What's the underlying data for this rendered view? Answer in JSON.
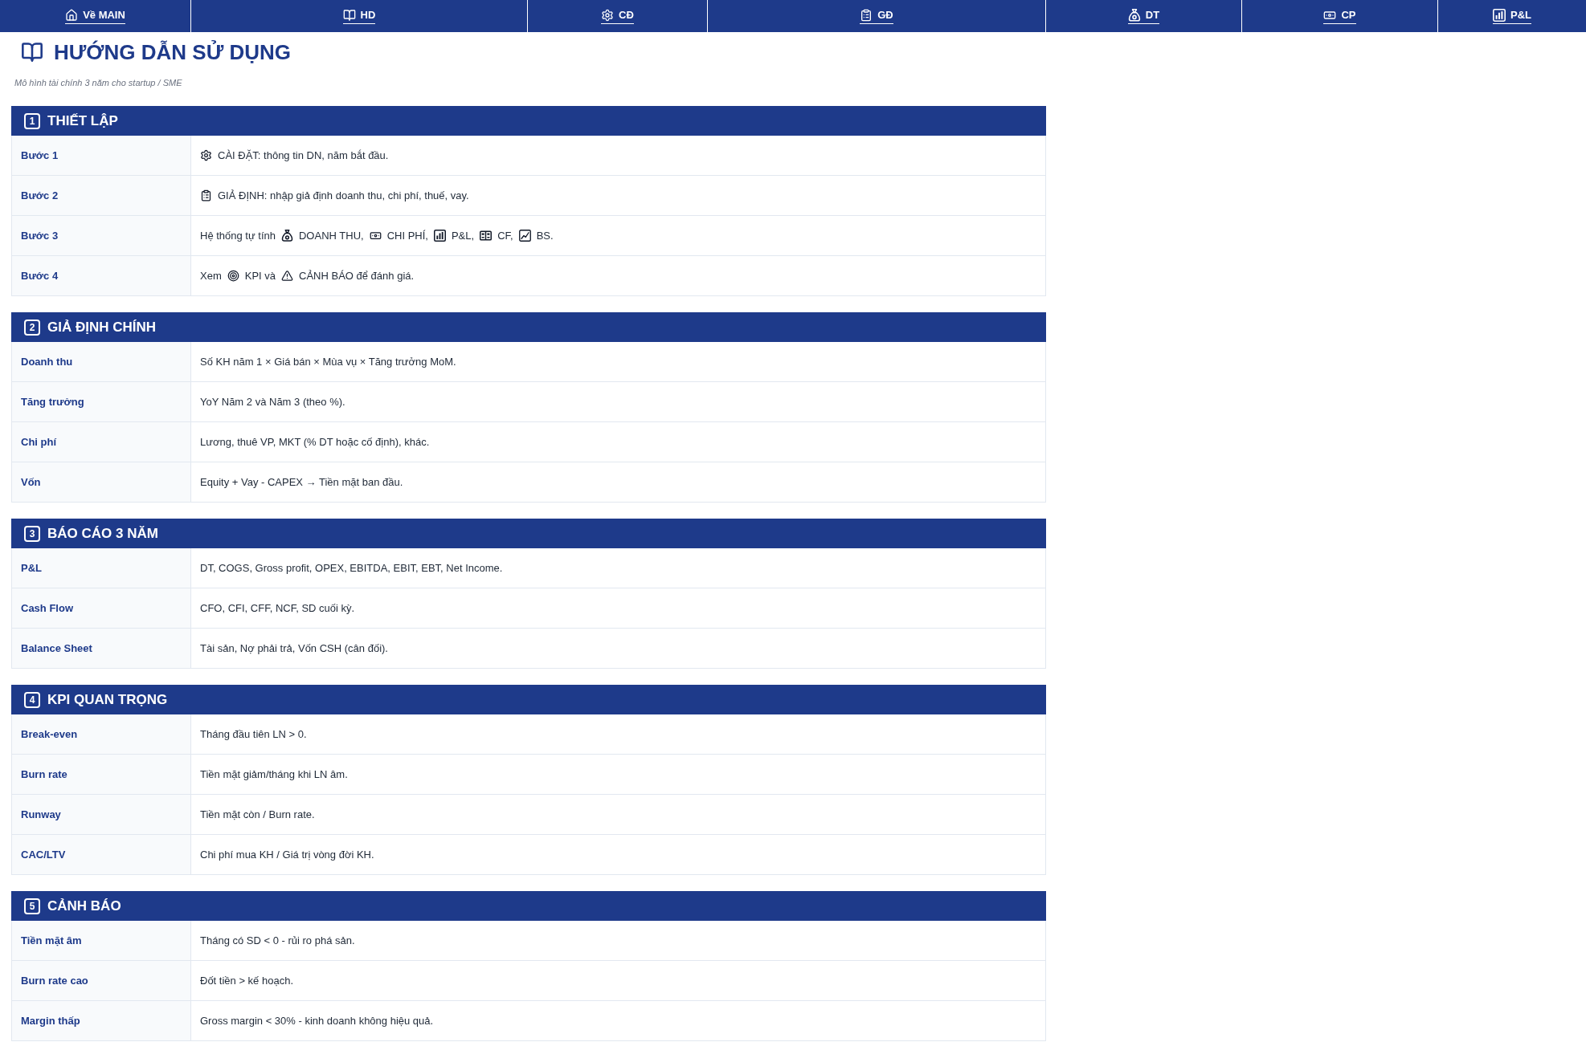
{
  "nav": [
    {
      "label": "Về MAIN"
    },
    {
      "label": "HD"
    },
    {
      "label": "CĐ"
    },
    {
      "label": "GĐ"
    },
    {
      "label": "DT"
    },
    {
      "label": "CP"
    },
    {
      "label": "P&L"
    }
  ],
  "title": "HƯỚNG DẪN SỬ DỤNG",
  "subtitle": "Mô hình tài chính 3 năm cho startup / SME",
  "sections": [
    {
      "number": "1",
      "title": "THIẾT LẬP",
      "rows": [
        {
          "label": "Bước 1",
          "parts": [
            {
              "kind": "icon"
            },
            {
              "kind": "text",
              "text": "CÀI ĐẶT: thông tin DN, năm bắt đầu."
            }
          ]
        },
        {
          "label": "Bước 2",
          "parts": [
            {
              "kind": "icon"
            },
            {
              "kind": "text",
              "text": "GIẢ ĐỊNH: nhập giả định doanh thu, chi phí, thuế, vay."
            }
          ]
        },
        {
          "label": "Bước 3",
          "parts": [
            {
              "kind": "text",
              "text": "Hệ thống tự tính"
            },
            {
              "kind": "icon"
            },
            {
              "kind": "text",
              "text": "DOANH THU,"
            },
            {
              "kind": "icon"
            },
            {
              "kind": "text",
              "text": "CHI PHÍ,"
            },
            {
              "kind": "icon"
            },
            {
              "kind": "text",
              "text": "P&L,"
            },
            {
              "kind": "icon"
            },
            {
              "kind": "text",
              "text": "CF,"
            },
            {
              "kind": "icon"
            },
            {
              "kind": "text",
              "text": "BS."
            }
          ]
        },
        {
          "label": "Bước 4",
          "parts": [
            {
              "kind": "text",
              "text": "Xem"
            },
            {
              "kind": "icon"
            },
            {
              "kind": "text",
              "text": "KPI và"
            },
            {
              "kind": "icon"
            },
            {
              "kind": "text",
              "text": "CẢNH BÁO để đánh giá."
            }
          ]
        }
      ]
    },
    {
      "number": "2",
      "title": "GIẢ ĐỊNH CHÍNH",
      "rows": [
        {
          "label": "Doanh thu",
          "parts": [
            {
              "kind": "text",
              "text": "Số KH năm 1 × Giá bán × Mùa vụ × Tăng trưởng MoM."
            }
          ]
        },
        {
          "label": "Tăng trưởng",
          "parts": [
            {
              "kind": "text",
              "text": "YoY Năm 2 và Năm 3 (theo %)."
            }
          ]
        },
        {
          "label": "Chi phí",
          "parts": [
            {
              "kind": "text",
              "text": "Lương, thuê VP, MKT (% DT hoặc cố định), khác."
            }
          ]
        },
        {
          "label": "Vốn",
          "parts": [
            {
              "kind": "text",
              "text": "Equity + Vay - CAPEX → Tiền mặt ban đầu."
            }
          ]
        }
      ]
    },
    {
      "number": "3",
      "title": "BÁO CÁO 3 NĂM",
      "rows": [
        {
          "label": "P&L",
          "parts": [
            {
              "kind": "text",
              "text": "DT, COGS, Gross profit, OPEX, EBITDA, EBIT, EBT, Net Income."
            }
          ]
        },
        {
          "label": "Cash Flow",
          "parts": [
            {
              "kind": "text",
              "text": "CFO, CFI, CFF, NCF, SD cuối kỳ."
            }
          ]
        },
        {
          "label": "Balance Sheet",
          "parts": [
            {
              "kind": "text",
              "text": "Tài sản, Nợ phải trả, Vốn CSH (cân đối)."
            }
          ]
        }
      ]
    },
    {
      "number": "4",
      "title": "KPI QUAN TRỌNG",
      "rows": [
        {
          "label": "Break-even",
          "parts": [
            {
              "kind": "text",
              "text": "Tháng đầu tiên LN > 0."
            }
          ]
        },
        {
          "label": "Burn rate",
          "parts": [
            {
              "kind": "text",
              "text": "Tiền mặt giảm/tháng khi LN âm."
            }
          ]
        },
        {
          "label": "Runway",
          "parts": [
            {
              "kind": "text",
              "text": "Tiền mặt còn / Burn rate."
            }
          ]
        },
        {
          "label": "CAC/LTV",
          "parts": [
            {
              "kind": "text",
              "text": "Chi phí mua KH / Giá trị vòng đời KH."
            }
          ]
        }
      ]
    },
    {
      "number": "5",
      "title": "CẢNH BÁO",
      "rows": [
        {
          "label": "Tiền mặt âm",
          "parts": [
            {
              "kind": "text",
              "text": "Tháng có SD < 0 - rủi ro phá sản."
            }
          ]
        },
        {
          "label": "Burn rate cao",
          "parts": [
            {
              "kind": "text",
              "text": "Đốt tiền > kế hoạch."
            }
          ]
        },
        {
          "label": "Margin thấp",
          "parts": [
            {
              "kind": "text",
              "text": "Gross margin < 30% - kinh doanh không hiệu quả."
            }
          ]
        }
      ]
    }
  ]
}
